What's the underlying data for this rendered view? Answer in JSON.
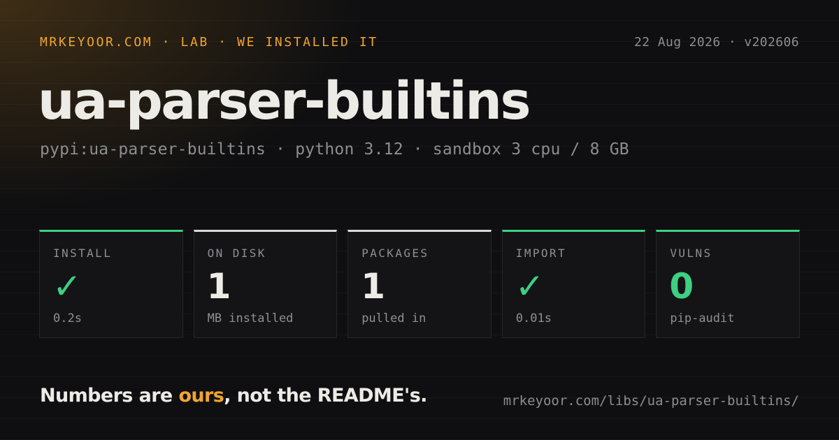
{
  "header": {
    "eyebrow": "MRKEYOOR.COM · LAB · WE INSTALLED IT",
    "meta": "22 Aug 2026 · v202606"
  },
  "title": "ua-parser-builtins",
  "subtitle": "pypi:ua-parser-builtins · python 3.12 · sandbox 3 cpu / 8 GB",
  "stats": [
    {
      "label": "INSTALL",
      "value": "✓",
      "note": "0.2s",
      "status": "ok",
      "accent_color": "#3ecf82"
    },
    {
      "label": "ON DISK",
      "value": "1",
      "note": "MB installed",
      "status": "neutral",
      "accent_color": "#d9d9d9"
    },
    {
      "label": "PACKAGES",
      "value": "1",
      "note": "pulled in",
      "status": "neutral",
      "accent_color": "#d9d9d9"
    },
    {
      "label": "IMPORT",
      "value": "✓",
      "note": "0.01s",
      "status": "ok",
      "accent_color": "#3ecf82"
    },
    {
      "label": "VULNS",
      "value": "0",
      "note": "pip-audit",
      "status": "ok",
      "accent_color": "#3ecf82"
    }
  ],
  "footer": {
    "tagline_prefix": "Numbers are ",
    "tagline_accent": "ours",
    "tagline_suffix": ", not the README's.",
    "url": "mrkeyoor.com/libs/ua-parser-builtins/"
  },
  "colors": {
    "brand_accent": "#f0a530",
    "success": "#3ecf82",
    "background": "#0f0f11",
    "text_primary": "#ecebe5",
    "text_muted": "#8d8d92"
  }
}
